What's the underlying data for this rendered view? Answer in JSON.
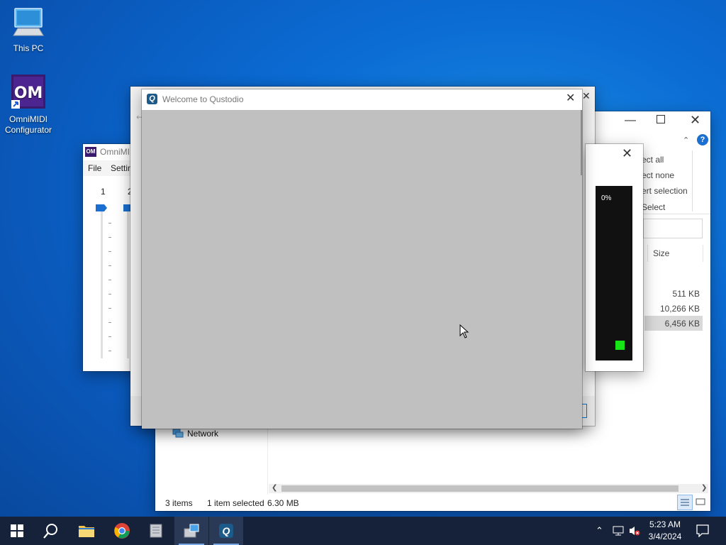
{
  "desktop": {
    "icons": [
      {
        "label": "This PC"
      },
      {
        "label": "OmniMIDI Configurator"
      }
    ]
  },
  "explorer": {
    "ribbon": [
      "Select all",
      "Select none",
      "Invert selection",
      "Select"
    ],
    "ribbon_visible": [
      "ect all",
      "ect none",
      "ert selection",
      "Select"
    ],
    "column_size": "Size",
    "sizes": [
      "511 KB",
      "10,266 KB",
      "6,456 KB"
    ],
    "nav_network": "Network",
    "status": {
      "items": "3 items",
      "selected": "1 item selected",
      "size": "6.30 MB"
    }
  },
  "omnimidi": {
    "title_partial": "OmniMI",
    "menu": {
      "file": "File",
      "settings_partial": "Settin"
    },
    "channel_1": "1",
    "channel_2_partial": "2"
  },
  "progress_dialog": {
    "percent": "0%"
  },
  "qustodio": {
    "title": "Welcome to Qustodio"
  },
  "taskbar": {
    "time": "5:23 AM",
    "date": "3/4/2024"
  },
  "colors": {
    "accent": "#0078d7",
    "qustodio_body": "#c0c0c0",
    "taskbar": "#15223a",
    "progress_green": "#16e616"
  }
}
